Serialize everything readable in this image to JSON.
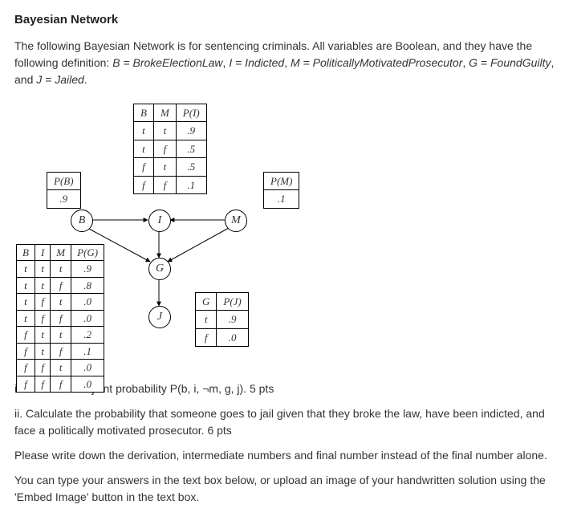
{
  "title": "Bayesian Network",
  "intro_p1": "The following Bayesian Network is for sentencing criminals. All variables are Boolean, and they have the following definition: ",
  "defs": {
    "b_eq": "B = BrokeElectionLaw",
    "i_eq": "I = Indicted",
    "m_eq": "M = PoliticallyMotivatedProsecutor",
    "g_eq": "G = FoundGuilty",
    "j_eq": "J = Jailed"
  },
  "tables": {
    "pb": {
      "header": "P(B)",
      "val": ".9"
    },
    "pm": {
      "header": "P(M)",
      "val": ".1"
    },
    "pi": {
      "h1": "B",
      "h2": "M",
      "h3": "P(I)",
      "rows": [
        [
          "t",
          "t",
          ".9"
        ],
        [
          "t",
          "f",
          ".5"
        ],
        [
          "f",
          "t",
          ".5"
        ],
        [
          "f",
          "f",
          ".1"
        ]
      ]
    },
    "pg": {
      "h1": "B",
      "h2": "I",
      "h3": "M",
      "h4": "P(G)",
      "rows": [
        [
          "t",
          "t",
          "t",
          ".9"
        ],
        [
          "t",
          "t",
          "f",
          ".8"
        ],
        [
          "t",
          "f",
          "t",
          ".0"
        ],
        [
          "t",
          "f",
          "f",
          ".0"
        ],
        [
          "f",
          "t",
          "t",
          ".2"
        ],
        [
          "f",
          "t",
          "f",
          ".1"
        ],
        [
          "f",
          "f",
          "t",
          ".0"
        ],
        [
          "f",
          "f",
          "f",
          ".0"
        ]
      ]
    },
    "pj": {
      "h1": "G",
      "h2": "P(J)",
      "rows": [
        [
          "t",
          ".9"
        ],
        [
          "f",
          ".0"
        ]
      ]
    }
  },
  "nodes": {
    "B": "B",
    "I": "I",
    "M": "M",
    "G": "G",
    "J": "J"
  },
  "q1": "i.  Calculate the joint probability P(b, i, ¬m, g, j). 5 pts",
  "q2": "ii.  Calculate the probability that someone goes to jail given that they broke the law, have been indicted, and face a politically motivated prosecutor.  6 pts",
  "note": "Please write down the derivation, intermediate numbers and final number instead of the final number alone.",
  "instr": "You can type your answers in the text box below, or upload an image of your handwritten solution using the 'Embed Image' button in the text box."
}
